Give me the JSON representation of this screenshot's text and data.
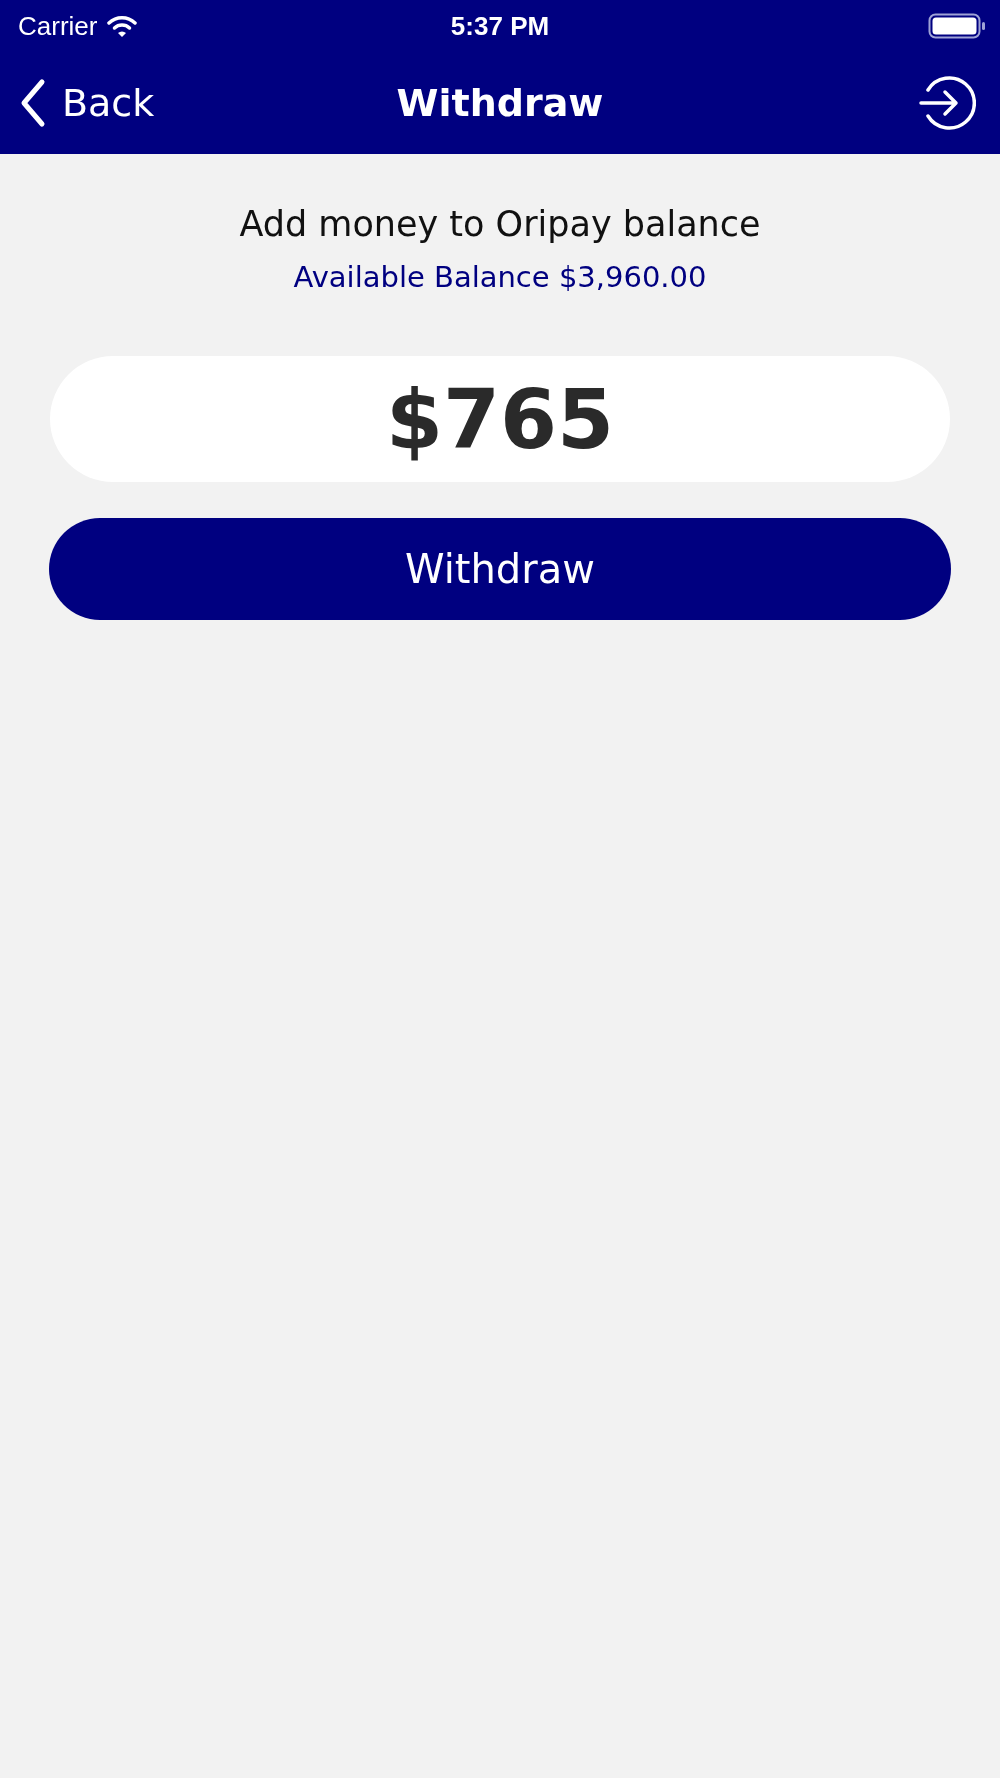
{
  "status_bar": {
    "carrier": "Carrier",
    "time": "5:37 PM"
  },
  "nav_bar": {
    "back_label": "Back",
    "title": "Withdraw"
  },
  "header": {
    "title": "Add money to Oripay balance",
    "balance": "Available Balance $3,960.00"
  },
  "amount_field": {
    "value": "$765"
  },
  "submit_button": {
    "label": "Withdraw"
  }
}
